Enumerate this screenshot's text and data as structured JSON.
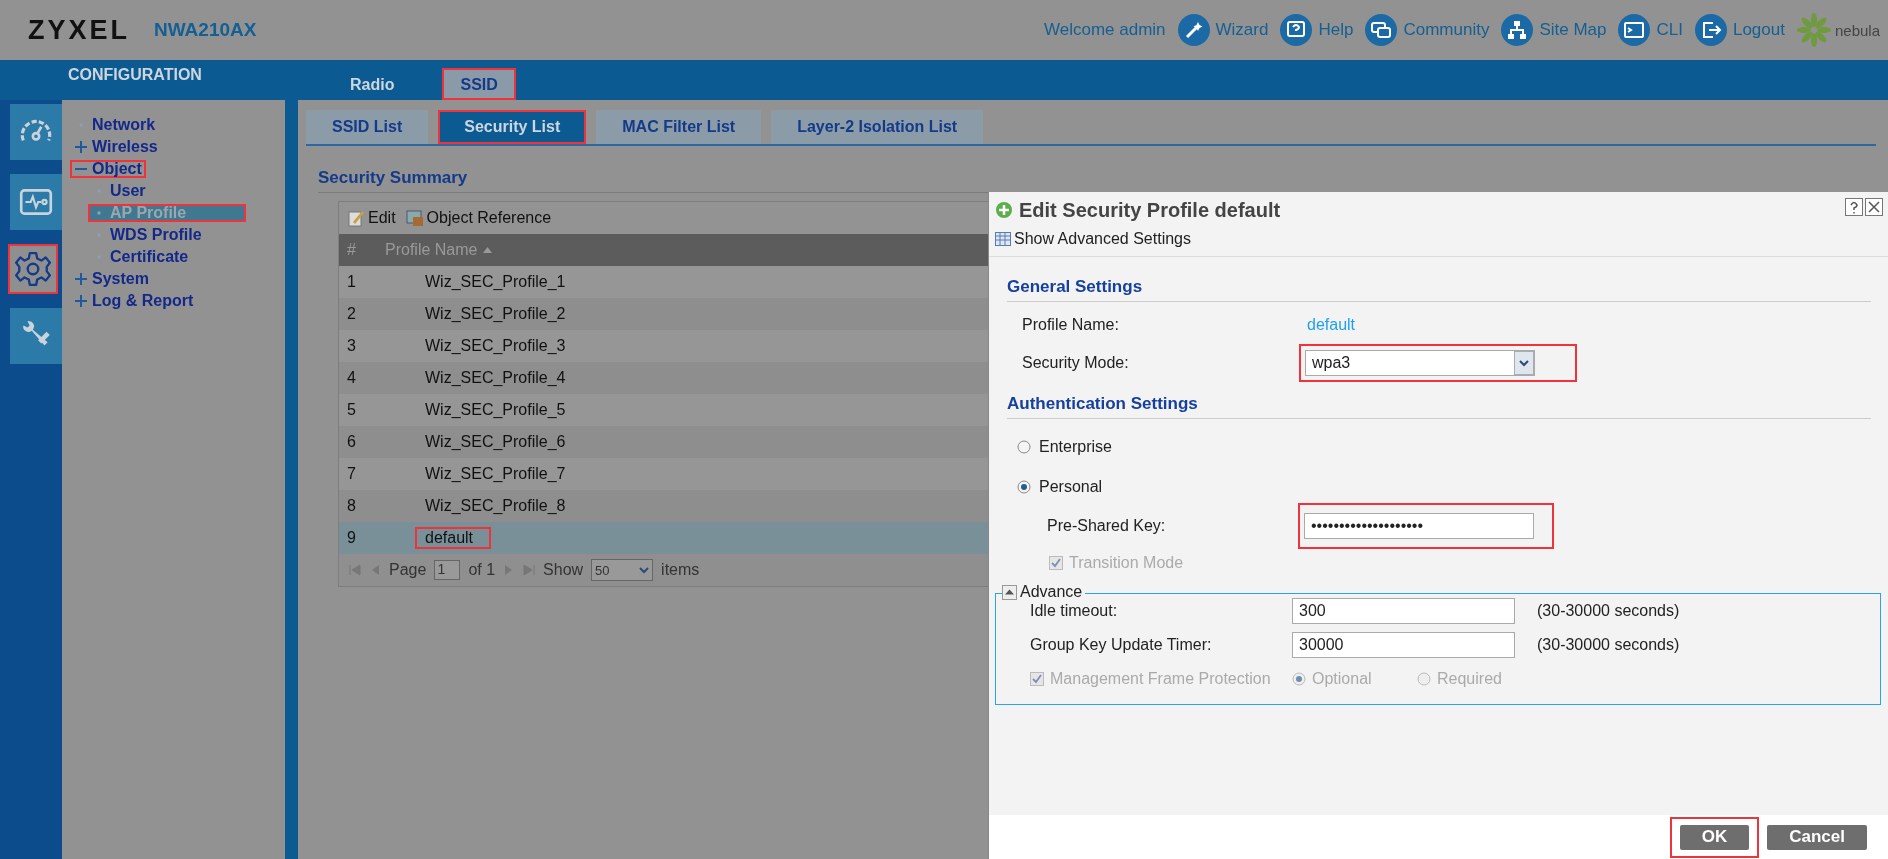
{
  "header": {
    "logo": "ZYXEL",
    "model": "NWA210AX",
    "welcome": "Welcome admin",
    "links": [
      {
        "kind": "wizard",
        "label": "Wizard"
      },
      {
        "kind": "help",
        "label": "Help"
      },
      {
        "kind": "community",
        "label": "Community"
      },
      {
        "kind": "sitemap",
        "label": "Site Map"
      },
      {
        "kind": "cli",
        "label": "CLI"
      },
      {
        "kind": "logout",
        "label": "Logout"
      }
    ],
    "brand": "nebula"
  },
  "section_title": "CONFIGURATION",
  "main_tabs": [
    {
      "label": "Radio",
      "selected": false,
      "highlighted": false
    },
    {
      "label": "SSID",
      "selected": true,
      "highlighted": true
    }
  ],
  "nav_rail": [
    {
      "kind": "dashboard",
      "selected": false,
      "highlighted": false
    },
    {
      "kind": "monitor",
      "selected": false,
      "highlighted": false
    },
    {
      "kind": "configuration",
      "selected": true,
      "highlighted": true
    },
    {
      "kind": "maintenance",
      "selected": false,
      "highlighted": false
    }
  ],
  "nav_tree": [
    {
      "label": "Network",
      "selected": false,
      "highlighted": false
    },
    {
      "label": "Wireless",
      "expanded": false,
      "selected": false,
      "highlighted": false
    },
    {
      "label": "Object",
      "expanded": true,
      "selected": false,
      "highlighted": true,
      "children": [
        {
          "label": "User",
          "selected": false,
          "highlighted": false
        },
        {
          "label": "AP Profile",
          "selected": true,
          "highlighted": true
        },
        {
          "label": "WDS Profile",
          "selected": false,
          "highlighted": false
        },
        {
          "label": "Certificate",
          "selected": false,
          "highlighted": false
        }
      ]
    },
    {
      "label": "System",
      "expanded": false,
      "selected": false,
      "highlighted": false
    },
    {
      "label": "Log & Report",
      "expanded": false,
      "selected": false,
      "highlighted": false
    }
  ],
  "sub_tabs": [
    {
      "label": "SSID List",
      "selected": false,
      "highlighted": false
    },
    {
      "label": "Security List",
      "selected": true,
      "highlighted": true
    },
    {
      "label": "MAC Filter List",
      "selected": false,
      "highlighted": false
    },
    {
      "label": "Layer-2 Isolation List",
      "selected": false,
      "highlighted": false
    }
  ],
  "summary": {
    "heading": "Security Summary",
    "toolbar": [
      {
        "kind": "edit",
        "label": "Edit"
      },
      {
        "kind": "reference",
        "label": "Object Reference"
      }
    ],
    "columns": [
      "#",
      "Profile Name"
    ],
    "rows": [
      {
        "cells": [
          "1",
          "Wiz_SEC_Profile_1"
        ],
        "selected": false,
        "highlighted": false
      },
      {
        "cells": [
          "2",
          "Wiz_SEC_Profile_2"
        ],
        "selected": false,
        "highlighted": false
      },
      {
        "cells": [
          "3",
          "Wiz_SEC_Profile_3"
        ],
        "selected": false,
        "highlighted": false
      },
      {
        "cells": [
          "4",
          "Wiz_SEC_Profile_4"
        ],
        "selected": false,
        "highlighted": false
      },
      {
        "cells": [
          "5",
          "Wiz_SEC_Profile_5"
        ],
        "selected": false,
        "highlighted": false
      },
      {
        "cells": [
          "6",
          "Wiz_SEC_Profile_6"
        ],
        "selected": false,
        "highlighted": false
      },
      {
        "cells": [
          "7",
          "Wiz_SEC_Profile_7"
        ],
        "selected": false,
        "highlighted": false
      },
      {
        "cells": [
          "8",
          "Wiz_SEC_Profile_8"
        ],
        "selected": false,
        "highlighted": false
      },
      {
        "cells": [
          "9",
          "default"
        ],
        "selected": true,
        "highlighted": true
      }
    ],
    "pager": {
      "page_label": "Page",
      "page": "1",
      "of": "of 1",
      "show_label": "Show",
      "show": "50",
      "items_label": "items"
    }
  },
  "dialog": {
    "title": "Edit Security Profile default",
    "toolbar": "Show Advanced Settings",
    "general": {
      "heading": "General Settings",
      "profile_label": "Profile Name:",
      "profile_value": "default",
      "mode_label": "Security Mode:",
      "mode_value": "wpa3",
      "mode_highlighted": true
    },
    "auth": {
      "heading": "Authentication Settings",
      "options": [
        {
          "label": "Enterprise",
          "selected": false
        },
        {
          "label": "Personal",
          "selected": true
        }
      ],
      "psk_label": "Pre-Shared Key:",
      "psk_value": "••••••••••••••••••••",
      "psk_highlighted": true,
      "transition": {
        "label": "Transition Mode",
        "checked": true,
        "disabled": true
      }
    },
    "advance": {
      "legend": "Advance",
      "expanded": true,
      "fields": [
        {
          "label": "Idle timeout:",
          "value": "300",
          "hint": "(30-30000 seconds)"
        },
        {
          "label": "Group Key Update Timer:",
          "value": "30000",
          "hint": "(30-30000 seconds)"
        }
      ],
      "mfp": {
        "label": "Management Frame Protection",
        "checked": true,
        "disabled": true
      },
      "mfp_options": [
        {
          "label": "Optional",
          "selected": true,
          "disabled": true
        },
        {
          "label": "Required",
          "selected": false,
          "disabled": true
        }
      ]
    },
    "buttons": [
      {
        "label": "OK",
        "highlighted": true
      },
      {
        "label": "Cancel",
        "highlighted": false
      }
    ]
  }
}
